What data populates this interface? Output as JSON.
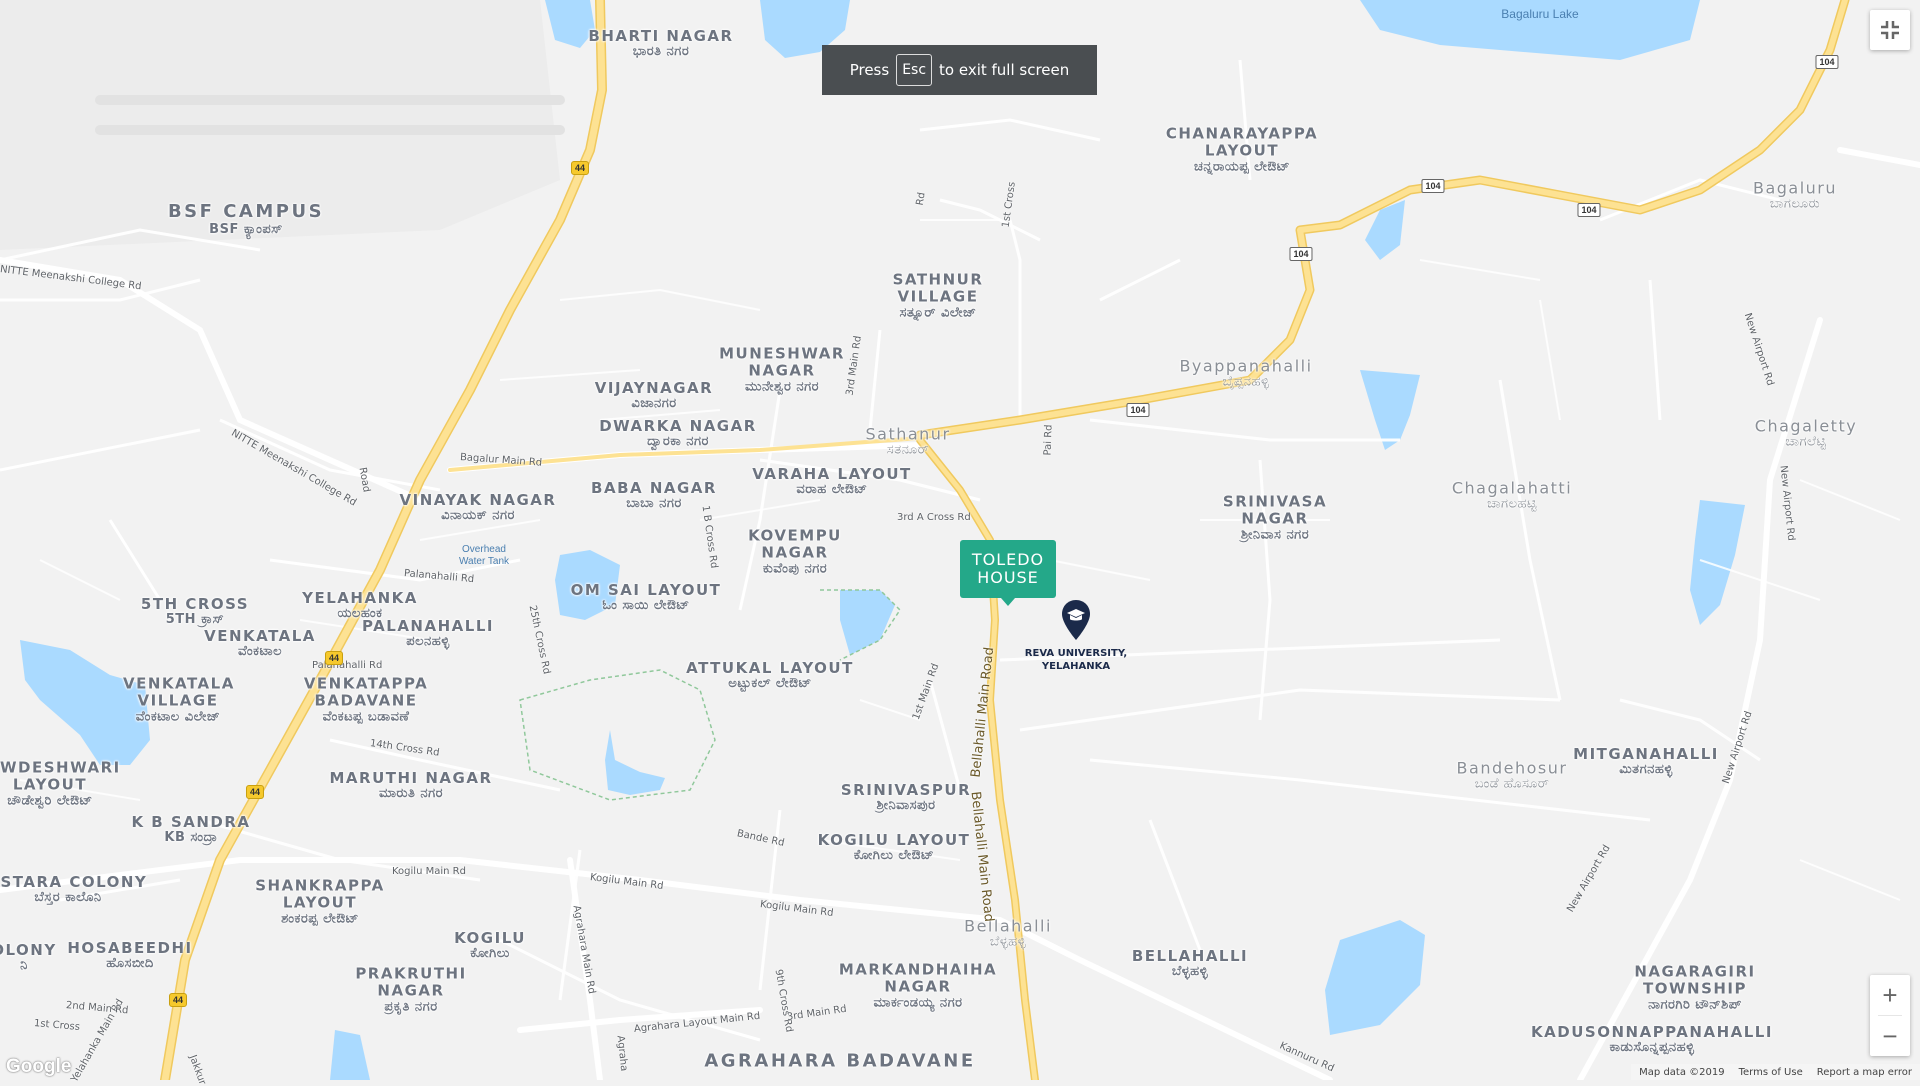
{
  "toast": {
    "press": "Press",
    "key": "Esc",
    "suffix": "to exit full screen"
  },
  "marker": {
    "line1": "TOLEDO",
    "line2": "HOUSE",
    "color": "#24a889"
  },
  "university": {
    "line1": "REVA UNIVERSITY,",
    "line2": "YELAHANKA",
    "icon": "graduation-cap-icon"
  },
  "places": [
    {
      "name": "BHARTI NAGAR",
      "local": "ಭಾರತಿ ನಗರ"
    },
    {
      "name": "BSF CAMPUS",
      "local": "BSF ಕ್ಯಾಂಪಸ್"
    },
    {
      "name": "CHANARAYAPPA LAYOUT",
      "local": "ಚನ್ನರಾಯಪ್ಪ ಲೇಔಟ್"
    },
    {
      "name": "SATHNUR VILLAGE",
      "local": "ಸತ್ನೂರ್ ವಿಲೇಜ್"
    },
    {
      "name": "MUNESHWAR NAGAR",
      "local": "ಮುನೇಶ್ವರ ನಗರ"
    },
    {
      "name": "VIJAYNAGAR",
      "local": "ವಿಜಾನಗರ"
    },
    {
      "name": "DWARKA NAGAR",
      "local": "ದ್ವಾರಕಾ ನಗರ"
    },
    {
      "name": "VARAHA LAYOUT",
      "local": "ವರಾಹ ಲೇಔಟ್"
    },
    {
      "name": "BABA NAGAR",
      "local": "ಬಾಬಾ ನಗರ"
    },
    {
      "name": "VINAYAK NAGAR",
      "local": "ವಿನಾಯಕ್ ನಗರ"
    },
    {
      "name": "KOVEMPU NAGAR",
      "local": "ಕುವೆಂಪು ನಗರ"
    },
    {
      "name": "OM SAI LAYOUT",
      "local": "ಓಂ ಸಾಯಿ ಲೇಔಟ್"
    },
    {
      "name": "YELAHANKA",
      "local": "ಯಲಹಂಕ"
    },
    {
      "name": "PALANAHALLI",
      "local": "ಪಲನಹಳ್ಳಿ"
    },
    {
      "name": "5TH CROSS",
      "local": "5TH ಕ್ರಾಸ್"
    },
    {
      "name": "VENKATALA",
      "local": "ವೆಂಕಟಾಲ"
    },
    {
      "name": "VENKATALA VILLAGE",
      "local": "ವೆಂಕಟಾಲ ವಿಲೇಜ್"
    },
    {
      "name": "VENKATAPPA BADAVANE",
      "local": "ವೆಂಕಟಪ್ಪ ಬಡಾವಣೆ"
    },
    {
      "name": "ATTUKAL LAYOUT",
      "local": "ಅಟ್ಟುಕಲ್ ಲೇಔಟ್"
    },
    {
      "name": "SRINIVASA NAGAR",
      "local": "ಶ್ರೀನಿವಾಸ ನಗರ"
    },
    {
      "name": "MARUTHI NAGAR",
      "local": "ಮಾರುತಿ ನಗರ"
    },
    {
      "name": "SRINIVASPUR",
      "local": "ಶ್ರೀನಿವಾಸಪುರ"
    },
    {
      "name": "KOGILU LAYOUT",
      "local": "ಕೋಗಿಲು ಲೇಔಟ್"
    },
    {
      "name": "K B SANDRA",
      "local": "KB ಸಂದ್ರಾ"
    },
    {
      "name": "SHANKRAPPA LAYOUT",
      "local": "ಶಂಕರಪ್ಪ ಲೇಔಟ್"
    },
    {
      "name": "KOGILU",
      "local": "ಕೋಗಿಲು"
    },
    {
      "name": "PRAKRUTHI NAGAR",
      "local": "ಪ್ರಕೃತಿ ನಗರ"
    },
    {
      "name": "MARKANDHAIHA NAGAR",
      "local": "ಮಾರ್ಕಂಡಯ್ಯ ನಗರ"
    },
    {
      "name": "BELLAHALLI",
      "local": "ಬೆಳ್ಳಹಳ್ಳಿ"
    },
    {
      "name": "MITGANAHALLI",
      "local": "ಮಿತಗನಹಳ್ಳಿ"
    },
    {
      "name": "NAGARAGIRI TOWNSHIP",
      "local": "ನಾಗರಗಿರಿ ಟೌನ್‌ಶಿಪ್"
    },
    {
      "name": "KADUSONNAPPANAHALLI",
      "local": "ಕಾಡುಸೊನ್ನಪ್ಪನಹಳ್ಳಿ"
    },
    {
      "name": "HOSABEEDHI",
      "local": "ಹೊಸಬೀದಿ"
    },
    {
      "name": "ESTARA COLONY",
      "local": "ಬೆಸ್ತರ ಕಾಲೊನಿ"
    },
    {
      "name": "OLONY",
      "local": "ನಿ"
    },
    {
      "name": "WDESHWARI LAYOUT",
      "local": "ಚೌಡೇಶ್ವರಿ ಲೇಔಟ್"
    },
    {
      "name": "AGRAHARA BADAVANE",
      "local": ""
    }
  ],
  "light_places": [
    {
      "name": "Sathanur",
      "local": "ಸತನೂರ್"
    },
    {
      "name": "Byappanahalli",
      "local": "ಬೈಪ್ಪನಹಳ್ಳಿ"
    },
    {
      "name": "Bagaluru",
      "local": "ಬಾಗಲೂರು"
    },
    {
      "name": "Chagaletty",
      "local": "ಚಾಗಲೆಟ್ಟಿ"
    },
    {
      "name": "Chagalahatti",
      "local": "ಚಾಗಲಹಟ್ಟಿ"
    },
    {
      "name": "Bandehosur",
      "local": "ಬಂಡೆ ಹೊಸೂರ್"
    },
    {
      "name": "Bellahalli",
      "local": "ಬೆಳ್ಳಹಳ್ಳಿ"
    }
  ],
  "water_labels": {
    "lake": "Bagaluru Lake",
    "tank": "Overhead Water Tank"
  },
  "roads": [
    "NITTE Meenakshi College Rd",
    "NITTE Meenakshi College Rd",
    "Bagalur Main Rd",
    "Palanahalli Rd",
    "Palanahalli Rd",
    "14th Cross Rd",
    "3rd A Cross Rd",
    "Bellahalli Main Road",
    "Bellahalli Main Road",
    "Kogilu Main Rd",
    "Kogilu Main Rd",
    "Kogilu Main Rd",
    "Agrahara Main Rd",
    "Agrahara Layout Main Rd",
    "New Airport Rd",
    "New Airport Rd",
    "New Airport Rd",
    "New Airport Rd",
    "Kannuru Rd",
    "1st Cross",
    "3rd Main Rd",
    "Pai Rd",
    "Bande Rd",
    "25th Cross Rd",
    "1 B Cross Rd",
    "1st Main Rd",
    "9th Cross Rd",
    "3rd Main Rd",
    "Yelahanka Main Rd",
    "2nd Main Rd",
    "1st Cross",
    "Road",
    "Agraha",
    "Rd",
    "Jakkur"
  ],
  "shields": {
    "nh": "44",
    "sh": "104"
  },
  "controls": {
    "zoom_in": "+",
    "zoom_out": "−"
  },
  "attribution": {
    "map_data": "Map data ©2019",
    "terms": "Terms of Use",
    "report": "Report a map error"
  },
  "logo": "Google",
  "colors": {
    "water": "#aadaff",
    "highway": "#fde293",
    "highway_border": "#f0c95e",
    "road": "#ffffff",
    "land": "#f2f2f2"
  }
}
